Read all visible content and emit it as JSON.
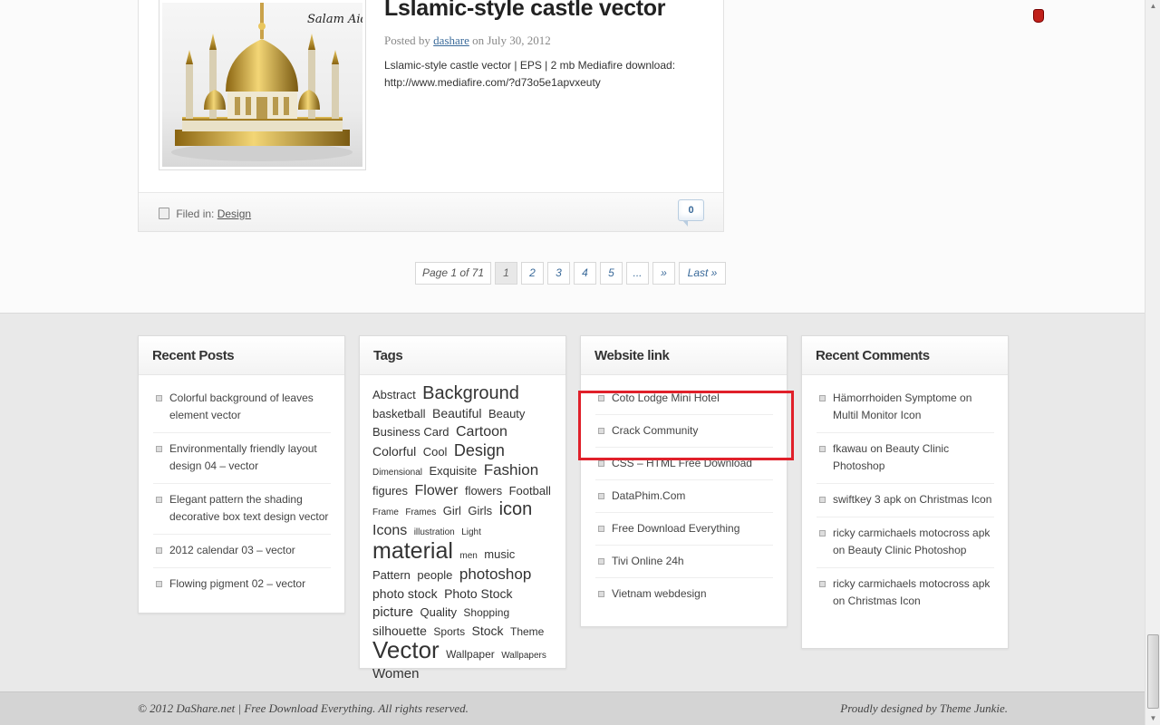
{
  "post": {
    "title": "Lslamic-style castle vector",
    "posted_by_prefix": "Posted by",
    "author": "dashare",
    "date_text": "on July 30, 2012",
    "excerpt": "Lslamic-style castle vector | EPS | 2 mb Mediafire download: http://www.mediafire.com/?d73o5e1apvxeuty",
    "filed_in_label": "Filed in:",
    "category": "Design",
    "comment_count": "0",
    "thumb_caption": "Salam Aidilfitri"
  },
  "pagination": {
    "info": "Page 1 of 71",
    "pages": [
      "1",
      "2",
      "3",
      "4",
      "5",
      "...",
      "»",
      "Last »"
    ]
  },
  "widgets": {
    "recent_posts": {
      "title": "Recent Posts",
      "items": [
        "Colorful background of leaves element vector",
        "Environmentally friendly layout design 04 – vector",
        "Elegant pattern the shading decorative box text design vector",
        "2012 calendar 03 – vector",
        "Flowing pigment 02 – vector"
      ]
    },
    "tags": {
      "title": "Tags",
      "items": [
        {
          "t": "Abstract",
          "s": 13
        },
        {
          "t": "Background",
          "s": 20
        },
        {
          "t": "basketball",
          "s": 13
        },
        {
          "t": "Beautiful",
          "s": 14
        },
        {
          "t": "Beauty",
          "s": 13
        },
        {
          "t": "Business Card",
          "s": 13
        },
        {
          "t": "Cartoon",
          "s": 16
        },
        {
          "t": "Colorful",
          "s": 14
        },
        {
          "t": "Cool",
          "s": 13
        },
        {
          "t": "Design",
          "s": 18
        },
        {
          "t": "Dimensional",
          "s": 10
        },
        {
          "t": "Exquisite",
          "s": 13
        },
        {
          "t": "Fashion",
          "s": 17
        },
        {
          "t": "figures",
          "s": 13
        },
        {
          "t": "Flower",
          "s": 16
        },
        {
          "t": "flowers",
          "s": 13
        },
        {
          "t": "Football",
          "s": 13
        },
        {
          "t": "Frame",
          "s": 10
        },
        {
          "t": "Frames",
          "s": 10
        },
        {
          "t": "Girl",
          "s": 13
        },
        {
          "t": "Girls",
          "s": 13
        },
        {
          "t": "icon",
          "s": 20
        },
        {
          "t": "Icons",
          "s": 16
        },
        {
          "t": "illustration",
          "s": 10
        },
        {
          "t": "Light",
          "s": 10
        },
        {
          "t": "material",
          "s": 25
        },
        {
          "t": "men",
          "s": 10
        },
        {
          "t": "music",
          "s": 13
        },
        {
          "t": "Pattern",
          "s": 13
        },
        {
          "t": "people",
          "s": 13
        },
        {
          "t": "photoshop",
          "s": 17
        },
        {
          "t": "photo stock",
          "s": 14
        },
        {
          "t": "Photo Stock",
          "s": 14
        },
        {
          "t": "picture",
          "s": 15
        },
        {
          "t": "Quality",
          "s": 13
        },
        {
          "t": "Shopping",
          "s": 12
        },
        {
          "t": "silhouette",
          "s": 14
        },
        {
          "t": "Sports",
          "s": 12
        },
        {
          "t": "Stock",
          "s": 14
        },
        {
          "t": "Theme",
          "s": 12
        },
        {
          "t": "Vector",
          "s": 26
        },
        {
          "t": "Wallpaper",
          "s": 12
        },
        {
          "t": "Wallpapers",
          "s": 10
        },
        {
          "t": "Women",
          "s": 15
        }
      ]
    },
    "website_link": {
      "title": "Website link",
      "items": [
        "Coto Lodge Mini Hotel",
        "Crack Community",
        "CSS – HTML Free Download",
        "DataPhim.Com",
        "Free Download Everything",
        "Tivi Online 24h",
        "Vietnam webdesign"
      ]
    },
    "recent_comments": {
      "title": "Recent Comments",
      "items": [
        "Hämorrhoiden Symptome on Multil Monitor Icon",
        "fkawau on Beauty Clinic Photoshop",
        "swiftkey 3 apk on Christmas Icon",
        "ricky carmichaels motocross apk on Beauty Clinic Photoshop",
        "ricky carmichaels motocross apk on Christmas Icon"
      ]
    }
  },
  "footer": {
    "copyright": "© 2012 DaShare.net | Free Download Everything. All rights reserved.",
    "credit": "Proudly designed by Theme Junkie."
  },
  "colors": {
    "link": "#3a6a9a",
    "highlight": "#e0202a"
  }
}
